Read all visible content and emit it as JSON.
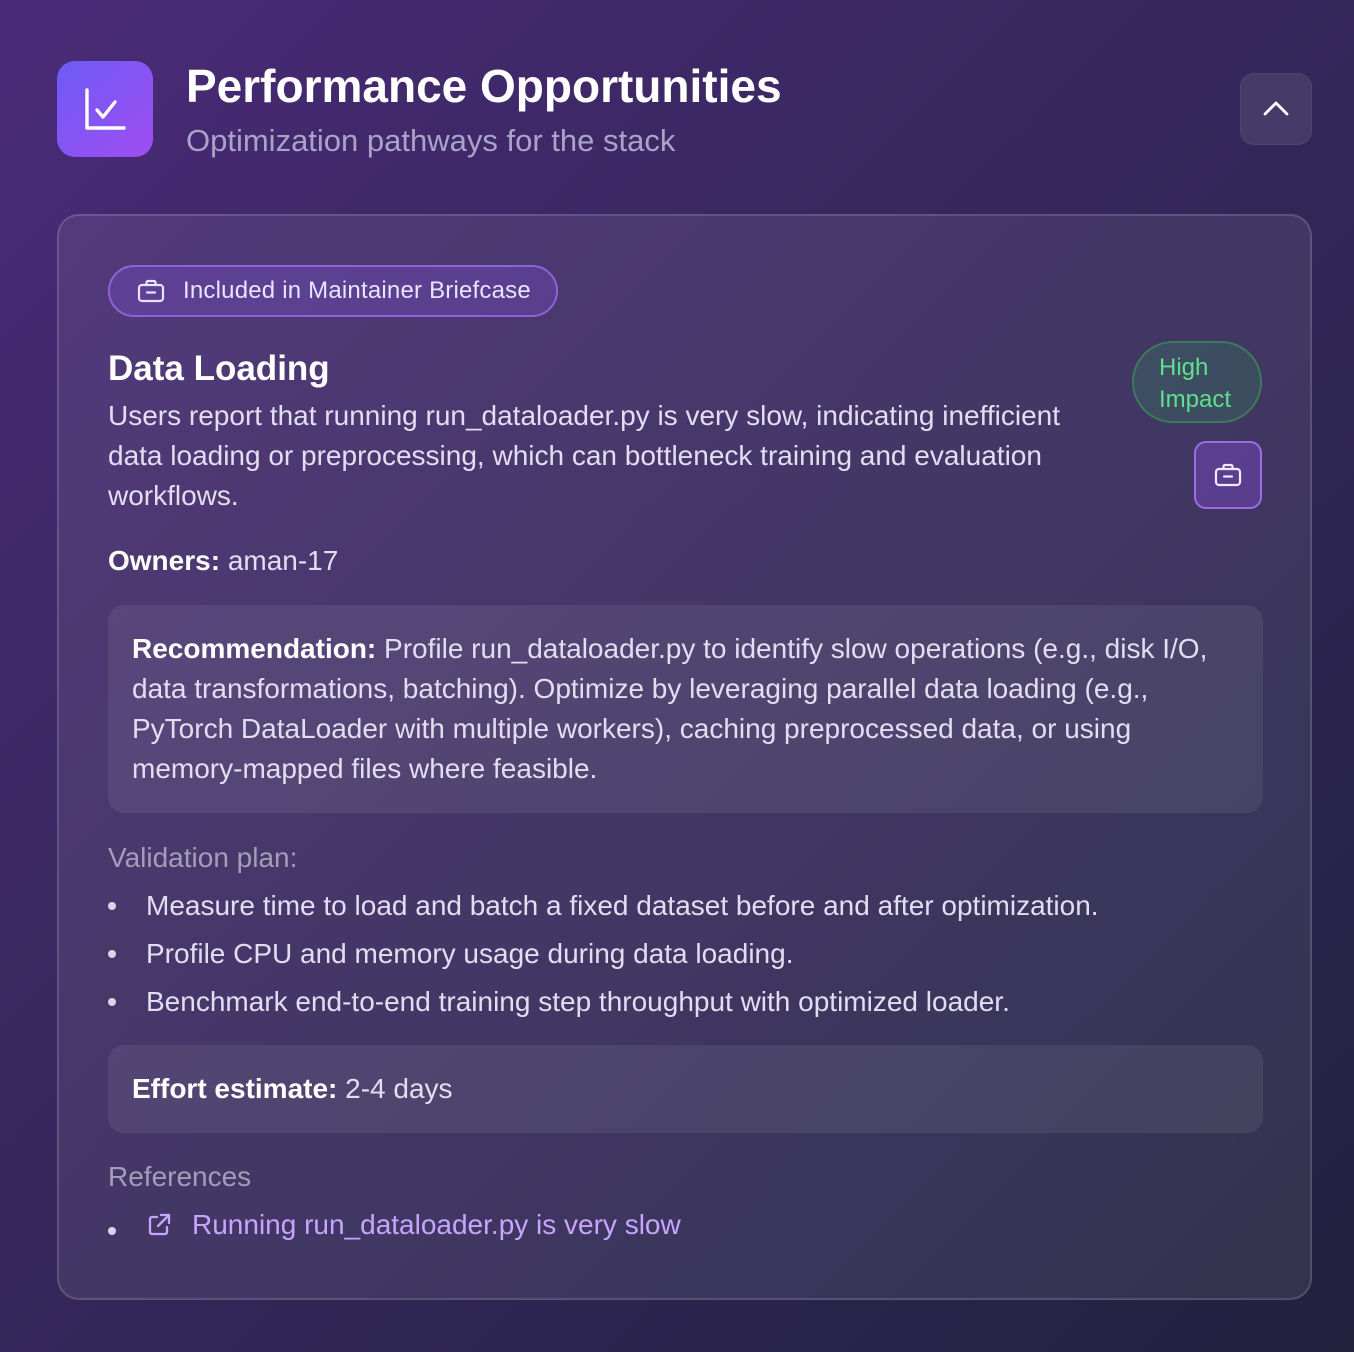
{
  "header": {
    "icon": "chart-check-icon",
    "title": "Performance Opportunities",
    "subtitle": "Optimization pathways for the stack",
    "collapse_icon": "chevron-up-icon"
  },
  "card": {
    "briefcase_pill": {
      "icon": "briefcase-icon",
      "label": "Included in Maintainer Briefcase"
    },
    "title": "Data Loading",
    "description": "Users report that running run_dataloader.py is very slow, indicating inefficient data loading or preprocessing, which can bottleneck training and evaluation workflows.",
    "impact_badge": "High Impact",
    "impact_color": "#5ee08c",
    "briefcase_button_icon": "briefcase-icon",
    "owners": {
      "label": "Owners:",
      "value": "aman-17"
    },
    "recommendation": {
      "label": "Recommendation:",
      "text": "Profile run_dataloader.py to identify slow operations (e.g., disk I/O, data transformations, batching). Optimize by leveraging parallel data loading (e.g., PyTorch DataLoader with multiple workers), caching preprocessed data, or using memory-mapped files where feasible."
    },
    "validation": {
      "label": "Validation plan:",
      "items": [
        "Measure time to load and batch a fixed dataset before and after optimization.",
        "Profile CPU and memory usage during data loading.",
        "Benchmark end-to-end training step throughput with optimized loader."
      ]
    },
    "effort": {
      "label": "Effort estimate:",
      "value": "2-4 days"
    },
    "references": {
      "label": "References",
      "items": [
        {
          "icon": "external-link-icon",
          "text": "Running run_dataloader.py is very slow"
        }
      ]
    },
    "accent_color": "#8f63d6",
    "link_color": "#c9a4ff"
  }
}
